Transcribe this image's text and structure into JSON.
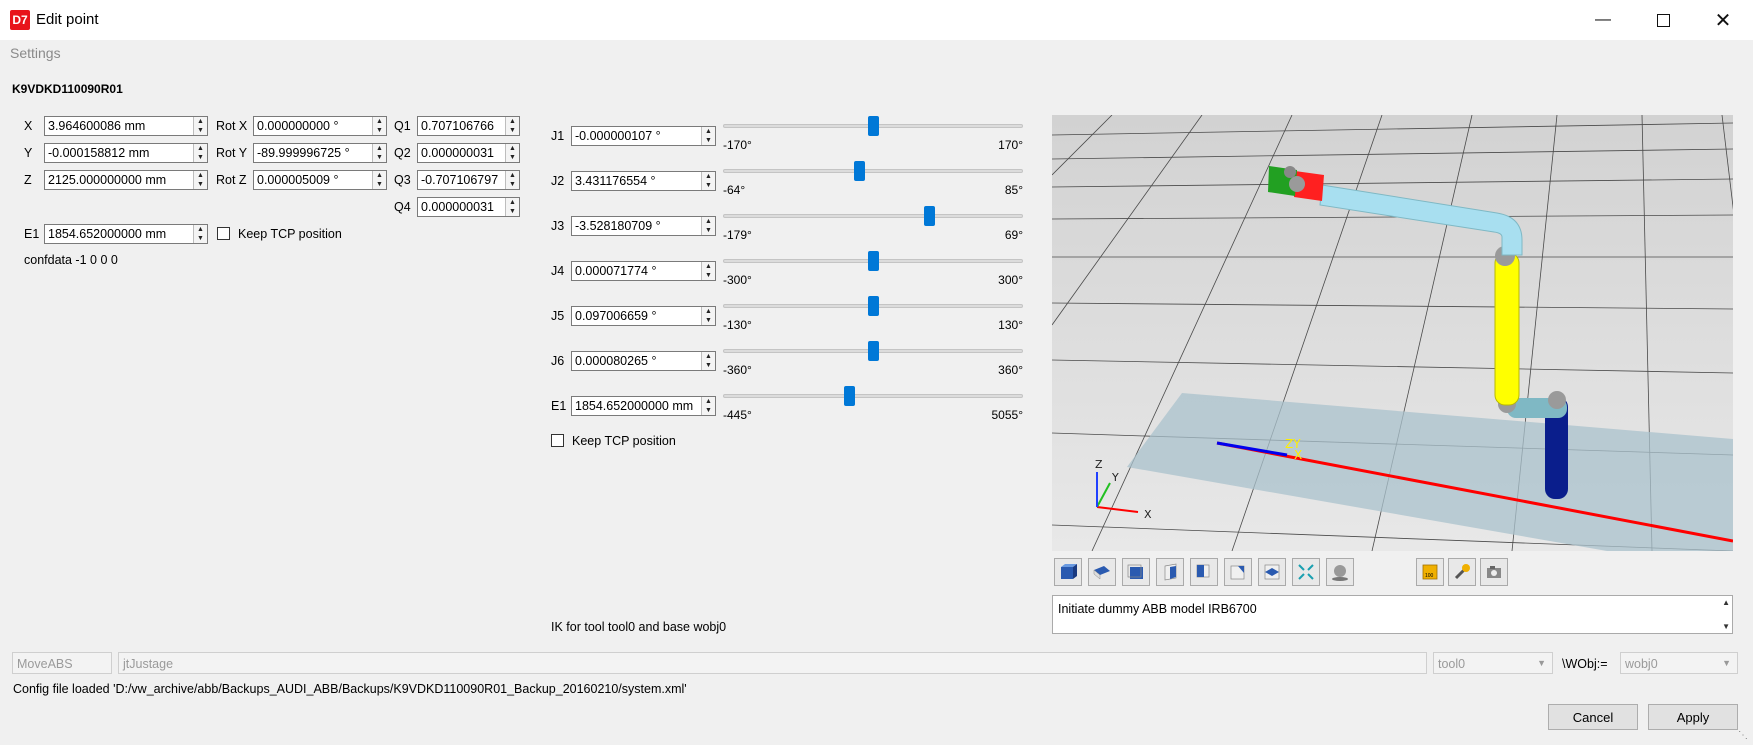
{
  "window": {
    "title": "Edit point",
    "app_icon": "D7"
  },
  "menu": {
    "settings": "Settings"
  },
  "robot_name": "K9VDKD110090R01",
  "cartesian": {
    "x": {
      "label": "X",
      "value": "3.964600086 mm"
    },
    "y": {
      "label": "Y",
      "value": "-0.000158812 mm"
    },
    "z": {
      "label": "Z",
      "value": "2125.000000000 mm"
    },
    "rotx": {
      "label": "Rot X",
      "value": "0.000000000 °"
    },
    "roty": {
      "label": "Rot Y",
      "value": "-89.999996725 °"
    },
    "rotz": {
      "label": "Rot Z",
      "value": "0.000005009 °"
    },
    "q1": {
      "label": "Q1",
      "value": "0.707106766"
    },
    "q2": {
      "label": "Q2",
      "value": "0.000000031"
    },
    "q3": {
      "label": "Q3",
      "value": "-0.707106797"
    },
    "q4": {
      "label": "Q4",
      "value": "0.000000031"
    },
    "e1": {
      "label": "E1",
      "value": "1854.652000000 mm"
    },
    "keep_tcp": "Keep TCP position",
    "confdata": "confdata -1 0 0 0"
  },
  "joints": [
    {
      "label": "J1",
      "value": "-0.000000107 °",
      "min": "-170°",
      "max": "170°",
      "position": 0.5
    },
    {
      "label": "J2",
      "value": "3.431176554 °",
      "min": "-64°",
      "max": "85°",
      "position": 0.452
    },
    {
      "label": "J3",
      "value": "-3.528180709 °",
      "min": "-179°",
      "max": "69°",
      "position": 0.697
    },
    {
      "label": "J4",
      "value": "0.000071774 °",
      "min": "-300°",
      "max": "300°",
      "position": 0.5
    },
    {
      "label": "J5",
      "value": "0.097006659 °",
      "min": "-130°",
      "max": "130°",
      "position": 0.5
    },
    {
      "label": "J6",
      "value": "0.000080265 °",
      "min": "-360°",
      "max": "360°",
      "position": 0.5
    },
    {
      "label": "E1",
      "value": "1854.652000000 mm",
      "min": "-445°",
      "max": "5055°",
      "position": 0.418
    }
  ],
  "joints_keep_tcp": "Keep TCP position",
  "ik_info": "IK for tool tool0 and base wobj0",
  "viewport": {
    "axis_labels": {
      "x": "X",
      "y": "Y",
      "z": "Z"
    }
  },
  "toolbar_icons": [
    "view-iso-icon",
    "view-top-icon",
    "view-front-icon",
    "view-right-icon",
    "view-left-icon",
    "view-back-icon",
    "view-bottom-icon",
    "fit-all-icon",
    "sphere-icon",
    "ruler-icon",
    "tool-icon",
    "camera-icon"
  ],
  "log_text": "Initiate dummy ABB model IRB6700",
  "instruction": {
    "move": "MoveABS",
    "name": "jtJustage",
    "tool": "tool0",
    "wobj_label": "\\WObj:=",
    "wobj": "wobj0"
  },
  "status": "Config file loaded 'D:/vw_archive/abb/Backups_AUDI_ABB/Backups/K9VDKD110090R01_Backup_20160210/system.xml'",
  "buttons": {
    "cancel": "Cancel",
    "apply": "Apply"
  },
  "colors": {
    "slider_handle": "#0078d7",
    "robot_yellow": "#ffff00",
    "robot_blue": "#0a1e8c",
    "robot_lightblue": "#a8dff0",
    "axis_red": "#ff0000"
  }
}
